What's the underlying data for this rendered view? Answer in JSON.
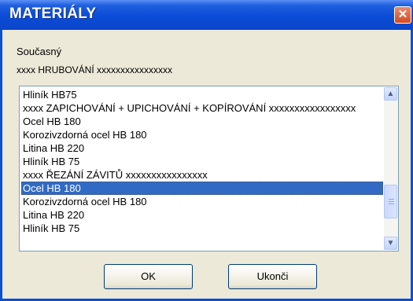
{
  "window": {
    "title": "MATERIÁLY",
    "close_glyph": "✕"
  },
  "current": {
    "label": "Současný",
    "value": "xxxx HRUBOVÁNÍ xxxxxxxxxxxxxxxx"
  },
  "list": {
    "items": [
      "Hliník HB75",
      "xxxx ZAPICHOVÁNÍ + UPICHOVÁNÍ + KOPÍROVÁNÍ xxxxxxxxxxxxxxxxx",
      "Ocel HB 180",
      "Korozivzdorná ocel HB 180",
      "Litina HB 220",
      "Hliník HB 75",
      "xxxx ŘEZÁNÍ ZÁVITŮ xxxxxxxxxxxxxxxx",
      "Ocel HB 180",
      "Korozivzdorná ocel HB 180",
      "Litina HB 220",
      "Hliník HB 75"
    ],
    "selected_index": 7
  },
  "buttons": {
    "ok_label": "OK",
    "exit_label": "Ukonči"
  },
  "colors": {
    "titlebar": "#0a4fd8",
    "selection": "#316ac5",
    "dialog_bg": "#ece9d8",
    "close_button": "#d34a22"
  }
}
